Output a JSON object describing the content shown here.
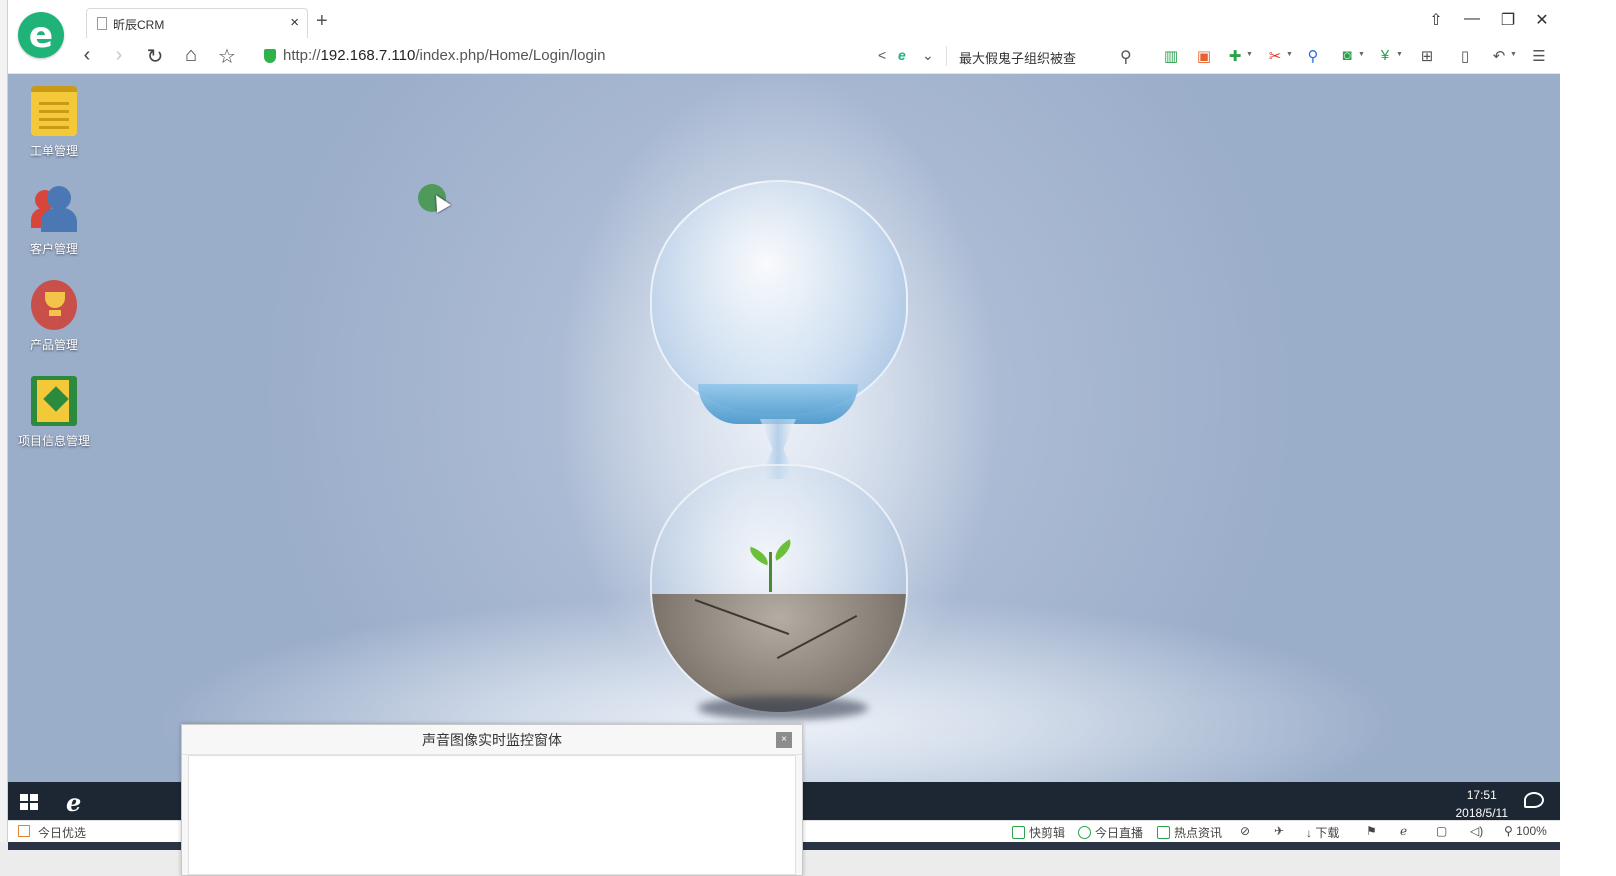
{
  "tab": {
    "title": "昕辰CRM",
    "close": "×",
    "new": "+"
  },
  "window_controls": {
    "pin": "⇧",
    "minimize": "—",
    "restore": "❐",
    "close": "✕"
  },
  "nav": {
    "back": "‹",
    "forward": "›",
    "refresh": "↻",
    "home": "⌂",
    "favorite": "☆",
    "url_prefix": "http://",
    "url_host": "192.168.7.110",
    "url_path": "/index.php/Home/Login/login",
    "share": "<",
    "engine": "e",
    "dropdown": "⌄",
    "search_text": "最大假鬼子组织被查",
    "search_icon": "⚲"
  },
  "toolbar_icons": [
    "book-icon",
    "tv-icon",
    "translate-icon",
    "cut-icon",
    "find-icon",
    "game-icon",
    "money-shield-icon",
    "apps-icon",
    "tablet-icon",
    "undo-icon",
    "menu-icon"
  ],
  "desktop": {
    "icons": [
      {
        "label": "工单管理",
        "icon": "notepad-icon"
      },
      {
        "label": "客户管理",
        "icon": "users-icon"
      },
      {
        "label": "产品管理",
        "icon": "trophy-icon"
      },
      {
        "label": "项目信息管理",
        "icon": "book-icon"
      }
    ]
  },
  "monitor_window": {
    "title": "声音图像实时监控窗体",
    "close": "×"
  },
  "taskbar": {
    "time": "17:51",
    "date": "2018/5/11"
  },
  "statusbar": {
    "left": "今日优选",
    "items": [
      "快剪辑",
      "今日直播",
      "热点资讯",
      "下载"
    ],
    "zoom": "100%"
  },
  "colors": {
    "accent": "#1fb37a",
    "taskbar": "#1d2633",
    "desktop": "#a8b8d2"
  }
}
